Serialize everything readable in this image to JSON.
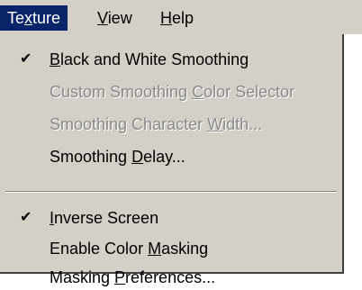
{
  "menubar": {
    "items": [
      {
        "label": "Texture",
        "pre": "Te",
        "mn": "x",
        "post": "ture"
      },
      {
        "label": "View",
        "pre": "",
        "mn": "V",
        "post": "iew"
      },
      {
        "label": "Help",
        "pre": "",
        "mn": "H",
        "post": "elp"
      }
    ]
  },
  "menu": {
    "items": [
      {
        "label": "Black and White Smoothing",
        "pre": "",
        "mn": "B",
        "post": "lack and White Smoothing",
        "checked": true,
        "disabled": false
      },
      {
        "label": "Custom Smoothing Color Selector",
        "pre": "Custom Smoothing ",
        "mn": "C",
        "post": "olor Selector",
        "checked": false,
        "disabled": true
      },
      {
        "label": "Smoothing Character Width...",
        "pre": "Smoothing Character ",
        "mn": "W",
        "post": "idth...",
        "checked": false,
        "disabled": true
      },
      {
        "label": "Smoothing Delay...",
        "pre": "Smoothing ",
        "mn": "D",
        "post": "elay...",
        "checked": false,
        "disabled": false
      },
      {
        "label": "Inverse Screen",
        "pre": "",
        "mn": "I",
        "post": "nverse Screen",
        "checked": true,
        "disabled": false
      },
      {
        "label": "Enable Color Masking",
        "pre": "Enable Color ",
        "mn": "M",
        "post": "asking",
        "checked": false,
        "disabled": false
      },
      {
        "label": "Masking Preferences...",
        "pre": "Masking ",
        "mn": "P",
        "post": "references...",
        "checked": false,
        "disabled": false
      }
    ],
    "check_glyph": "✔"
  },
  "colors": {
    "highlight": "#0a246a",
    "menu_bg": "#d4d0c8",
    "disabled_text": "#8a8a8a"
  }
}
